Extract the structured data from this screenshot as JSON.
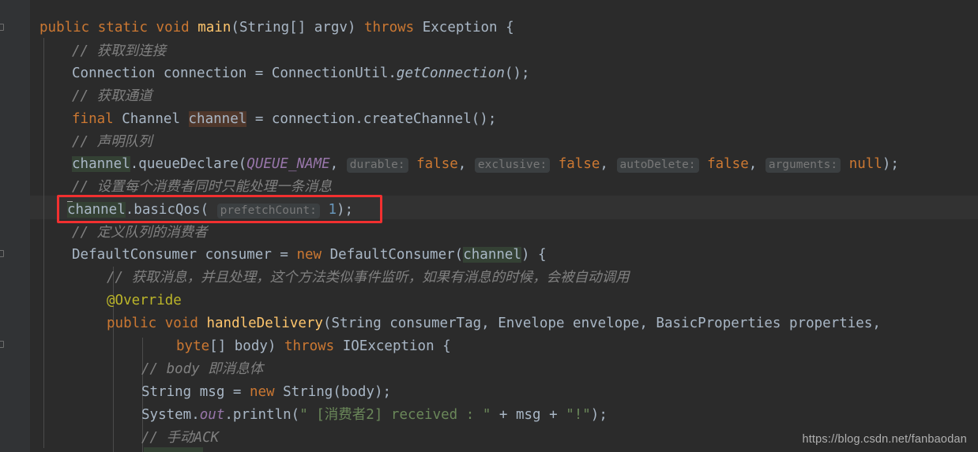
{
  "editor": {
    "theme_name": "darcula",
    "background_color": "#2b2b2b",
    "gutter_color": "#313335",
    "caret_line_color": "#323232",
    "default_text_color": "#a9b7c6",
    "keyword_color": "#cc7832",
    "string_color": "#6a8759",
    "number_color": "#6897bb",
    "comment_color": "#808080",
    "method_color": "#ffc66d",
    "annotation_color": "#bbb529",
    "static_field_color": "#9876aa",
    "hint_color": "#787878",
    "usage_highlight_green": "#344134",
    "usage_highlight_brown": "#4f372b",
    "annotation_box_color": "#f23030"
  },
  "code": {
    "language": "java",
    "lines": [
      {
        "text": "public static void main(String[] argv) throws Exception {",
        "tokens": [
          {
            "t": "public",
            "c": "kw"
          },
          {
            "t": " ",
            "c": "punc"
          },
          {
            "t": "static",
            "c": "kw"
          },
          {
            "t": " ",
            "c": "punc"
          },
          {
            "t": "void",
            "c": "kw"
          },
          {
            "t": " ",
            "c": "punc"
          },
          {
            "t": "main",
            "c": "method"
          },
          {
            "t": "(",
            "c": "punc"
          },
          {
            "t": "String",
            "c": "type"
          },
          {
            "t": "[] argv) ",
            "c": "punc"
          },
          {
            "t": "throws",
            "c": "kw"
          },
          {
            "t": " Exception {",
            "c": "punc"
          }
        ]
      },
      {
        "text": "// 获取到连接"
      },
      {
        "text": "Connection connection = ConnectionUtil.getConnection();"
      },
      {
        "text": "// 获取通道"
      },
      {
        "text": "final Channel channel = connection.createChannel();"
      },
      {
        "text": "// 声明队列"
      },
      {
        "text": "channel.queueDeclare(QUEUE_NAME, durable: false, exclusive: false, autoDelete: false, arguments: null);"
      },
      {
        "text": "// 设置每个消费者同时只能处理一条消息"
      },
      {
        "text": "channel.basicQos( prefetchCount: 1);"
      },
      {
        "text": "// 定义队列的消费者"
      },
      {
        "text": "DefaultConsumer consumer = new DefaultConsumer(channel) {"
      },
      {
        "text": "// 获取消息，并且处理，这个方法类似事件监听，如果有消息的时候，会被自动调用"
      },
      {
        "text": "@Override"
      },
      {
        "text": "public void handleDelivery(String consumerTag, Envelope envelope, BasicProperties properties,"
      },
      {
        "text": "byte[] body) throws IOException {"
      },
      {
        "text": "// body 即消息体"
      },
      {
        "text": "String msg = new String(body);"
      },
      {
        "text": "System.out.println(\" [消费者2] received : \" + msg + \"!\");"
      },
      {
        "text": "// 手动ACK"
      }
    ],
    "l1_public": "public",
    "l1_static": "static",
    "l1_void": "void",
    "l1_main": "main",
    "l1_open_paren": "(",
    "l1_string_type": "String",
    "l1_argv": "[] argv) ",
    "l1_throws": "throws",
    "l1_exception": " Exception {",
    "l2_comment": "// 获取到连接",
    "l3_conn_type": "Connection connection = ConnectionUtil.",
    "l3_get_connection": "getConnection",
    "l3_tail": "();",
    "l4_comment": "// 获取通道",
    "l5_final": "final",
    "l5_mid": " Channel ",
    "l5_channel": "channel",
    "l5_tail": " = connection.createChannel();",
    "l6_comment": "// 声明队列",
    "l7_channel": "channel",
    "l7_queue_declare": ".queueDeclare(",
    "l7_queue_name": "QUEUE_NAME",
    "l7_comma1": ", ",
    "l7_hint_durable": "durable:",
    "l7_false1": "false",
    "l7_comma2": ", ",
    "l7_hint_exclusive": "exclusive:",
    "l7_false2": "false",
    "l7_comma3": ", ",
    "l7_hint_autodelete": "autoDelete:",
    "l7_false3": "false",
    "l7_comma4": ", ",
    "l7_hint_arguments": "arguments:",
    "l7_null": "null",
    "l7_tail": ");",
    "l8_comment": "// 设置每个消费者同时只能处理一条消息",
    "l9_channel": "channel",
    "l9_basic_qos": ".basicQos( ",
    "l9_hint_prefetch": "prefetchCount:",
    "l9_one": "1",
    "l9_tail": ");",
    "l10_comment": "// 定义队列的消费者",
    "l11_head": "DefaultConsumer consumer = ",
    "l11_new": "new",
    "l11_mid": " DefaultConsumer(",
    "l11_channel": "channel",
    "l11_tail": ") {",
    "l12_comment": "// 获取消息，并且处理，这个方法类似事件监听，如果有消息的时候，会被自动调用",
    "l13_override": "@Override",
    "l14_public": "public",
    "l14_void": "void",
    "l14_handle_delivery": "handleDelivery",
    "l14_params": "(String consumerTag, Envelope envelope, BasicProperties properties,",
    "l15_byte": "byte",
    "l15_body": "[] body) ",
    "l15_throws": "throws",
    "l15_ioexception": " IOException {",
    "l16_comment": "// body 即消息体",
    "l17_head": "String msg = ",
    "l17_new": "new",
    "l17_tail": " String(body);",
    "l18_system": "System.",
    "l18_out": "out",
    "l18_println": ".println(",
    "l18_str1": "\" [消费者2] received : \"",
    "l18_plus1": " + msg + ",
    "l18_str2": "\"!\"",
    "l18_tail": ");",
    "l19_comment": "// 手动ACK"
  },
  "annotation": {
    "shape": "rectangle",
    "color": "#f23030",
    "target_line": "channel.basicQos( prefetchCount: 1);"
  },
  "watermark": {
    "text": "https://blog.csdn.net/fanbaodan"
  }
}
